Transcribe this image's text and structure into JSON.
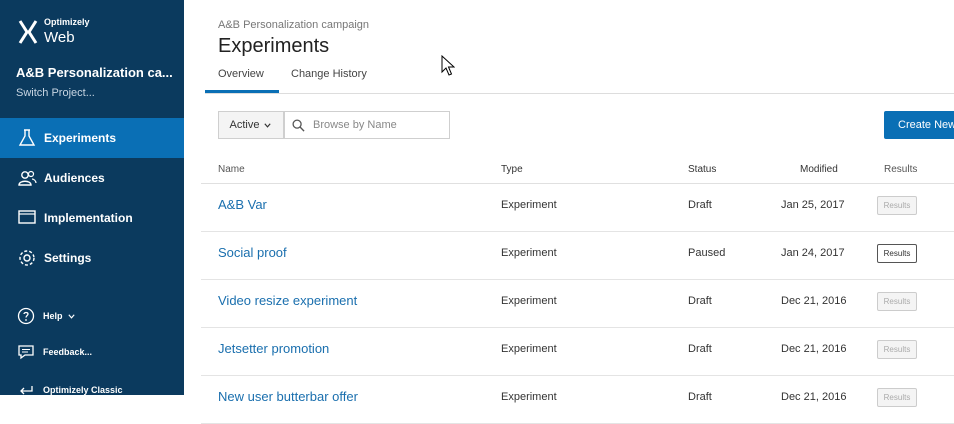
{
  "sidebar": {
    "brand": "Optimizely",
    "product": "Web",
    "project_name": "A&B Personalization ca...",
    "switch_project": "Switch Project...",
    "nav": [
      {
        "label": "Experiments",
        "icon": "flask-icon",
        "active": true
      },
      {
        "label": "Audiences",
        "icon": "users-icon",
        "active": false
      },
      {
        "label": "Implementation",
        "icon": "monitor-icon",
        "active": false
      },
      {
        "label": "Settings",
        "icon": "gear-icon",
        "active": false
      }
    ],
    "help": "Help",
    "feedback": "Feedback...",
    "classic": "Optimizely Classic"
  },
  "header": {
    "breadcrumb": "A&B Personalization campaign",
    "title": "Experiments",
    "tabs": [
      "Overview",
      "Change History"
    ]
  },
  "toolbar": {
    "filter_label": "Active",
    "search_placeholder": "Browse by Name",
    "create_label": "Create New"
  },
  "table": {
    "headers": {
      "name": "Name",
      "type": "Type",
      "status": "Status",
      "modified": "Modified",
      "results": "Results"
    },
    "rows": [
      {
        "name": "A&B Var",
        "type": "Experiment",
        "status": "Draft",
        "modified": "Jan 25, 2017",
        "results": "Results",
        "results_enabled": false
      },
      {
        "name": "Social proof",
        "type": "Experiment",
        "status": "Paused",
        "modified": "Jan 24, 2017",
        "results": "Results",
        "results_enabled": true
      },
      {
        "name": "Video resize experiment",
        "type": "Experiment",
        "status": "Draft",
        "modified": "Dec 21, 2016",
        "results": "Results",
        "results_enabled": false
      },
      {
        "name": "Jetsetter promotion",
        "type": "Experiment",
        "status": "Draft",
        "modified": "Dec 21, 2016",
        "results": "Results",
        "results_enabled": false
      },
      {
        "name": "New user butterbar offer",
        "type": "Experiment",
        "status": "Draft",
        "modified": "Dec 21, 2016",
        "results": "Results",
        "results_enabled": false
      }
    ]
  },
  "colors": {
    "sidebar": "#0b3a5e",
    "accent": "#0a6fb5",
    "link": "#1a6fae"
  }
}
